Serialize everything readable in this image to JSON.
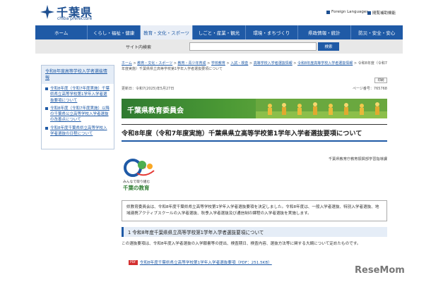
{
  "header": {
    "logo_text": "千葉県",
    "logo_sub": "chiba prefecture",
    "links": [
      "Foreign Languages",
      "閲覧補助機能"
    ]
  },
  "nav": {
    "items": [
      "ホーム",
      "くらし・福祉・健康",
      "教育・文化・スポーツ",
      "しごと・産業・観光",
      "環境・まちづくり",
      "県政情報・統計",
      "防災・安全・安心"
    ],
    "active_index": 2
  },
  "search": {
    "label": "サイト内検索",
    "button": "検索",
    "value": ""
  },
  "sidebar": {
    "heading": "令和8年度高等学校入学者選抜情報",
    "items": [
      "令和8年度（令和7年度実施）千葉県県立高等学校第1学年入学者選抜要項について",
      "令和8年度（令和7年度実施）以降の千葉県公立高等学校入学者選抜の改善点について",
      "令和8年度千葉県県立高等学校入学者選抜の日程について"
    ]
  },
  "breadcrumb": {
    "items": [
      "ホーム",
      "教育・文化・スポーツ",
      "教育・青少年育成",
      "学校教育",
      "入試・検査",
      "高等学校入学者選抜情報",
      "令和8年度高等学校入学者選抜情報"
    ],
    "current": "令和8年度（令和7年度実施）千葉県県立高等学校第1学年入学者選抜要項について"
  },
  "print_label": "印刷",
  "meta": {
    "updated": "更新日：令和7(2025)年5月27日",
    "page_number": "ページ番号：765768"
  },
  "banner": {
    "text": "千葉県教育委員会"
  },
  "page_title": "令和8年度（令和7年度実施）千葉県県立高等学校第1学年入学者選抜要項について",
  "department": "千葉県教育庁教育振興部学習指導課",
  "edu_logo": {
    "caption1": "みんなで取り組む",
    "caption2": "千葉の教育",
    "icon_name": "chiba-education-logo-icon"
  },
  "notice": "県教育委員会は、令和8年度千葉県県立高等学校第1学年入学者選抜要項を決定しました。令和8年度は、一般入学者選抜、特別入学者選抜、地域連携アクティブスクールの入学者選抜、秋季入学者選抜及び通信制の課程の入学者選抜を実施します。",
  "section": {
    "heading": "1 令和8年度千葉県県立高等学校第1学年入学者選抜要項について",
    "text": "この選抜要項は、令和8年度入学者選抜の入学願書等の提出、検査期日、検査内容、選抜方法等に関する大綱について定めたものです。",
    "pdf_badge": "PDF",
    "pdf_link": "令和8年度千葉県県立高等学校第1学年入学者選抜要項（PDF：251.5KB）"
  },
  "watermark": "ReseMom"
}
